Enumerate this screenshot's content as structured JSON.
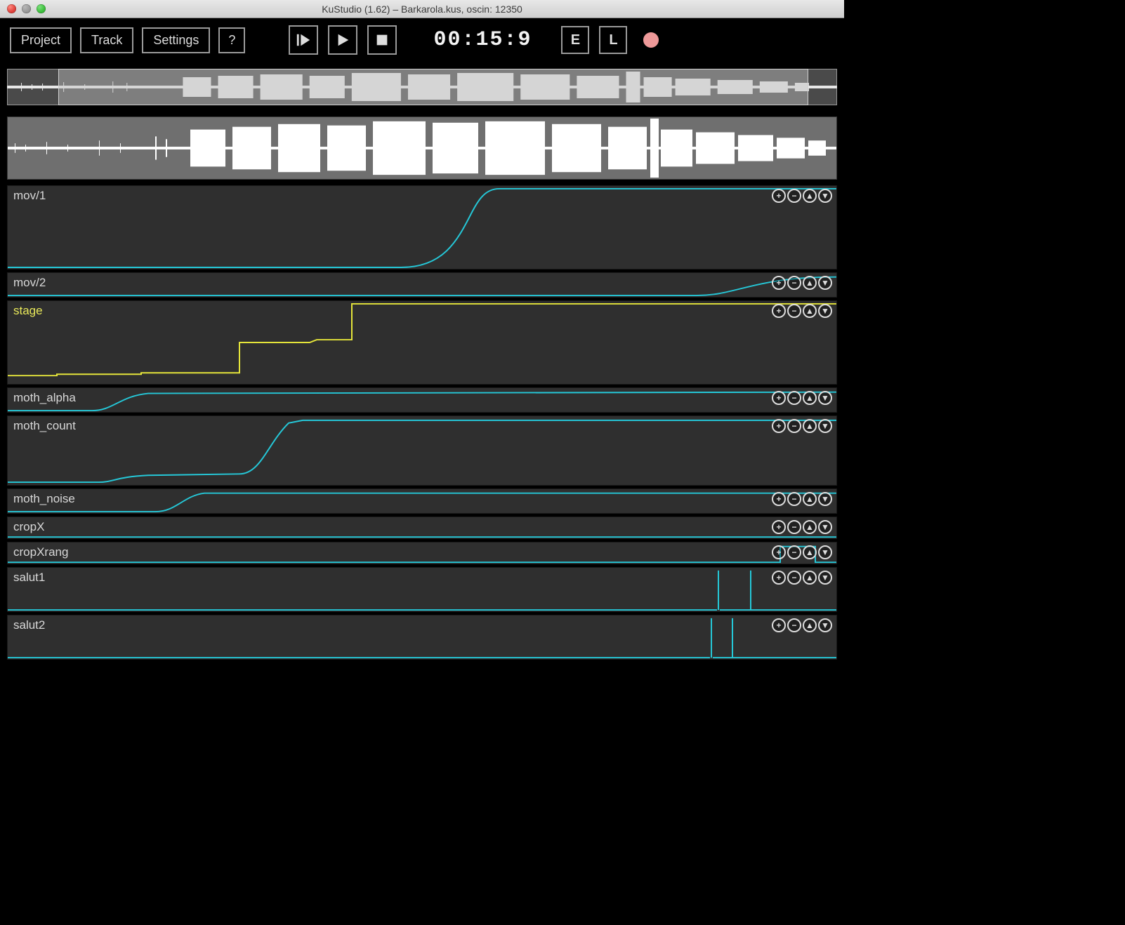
{
  "window": {
    "title": "KuStudio (1.62) – Barkarola.kus, oscin: 12350"
  },
  "toolbar": {
    "project_label": "Project",
    "track_label": "Track",
    "settings_label": "Settings",
    "help_label": "?",
    "timecode": "00:15:9",
    "mode_e": "E",
    "mode_l": "L"
  },
  "overview": {
    "selection_start_pct": 6.2,
    "selection_end_pct": 96.5
  },
  "tracks": [
    {
      "name": "mov/1",
      "color": "cyan",
      "height": "lg"
    },
    {
      "name": "mov/2",
      "color": "cyan",
      "height": "sm"
    },
    {
      "name": "stage",
      "color": "yellow",
      "height": "lg"
    },
    {
      "name": "moth_alpha",
      "color": "cyan",
      "height": "sm"
    },
    {
      "name": "moth_count",
      "color": "cyan",
      "height": "md"
    },
    {
      "name": "moth_noise",
      "color": "cyan",
      "height": "sm"
    },
    {
      "name": "cropX",
      "color": "cyan",
      "height": "xs"
    },
    {
      "name": "cropXrang",
      "color": "cyan",
      "height": "xs"
    },
    {
      "name": "salut1",
      "color": "cyan",
      "height": "sl"
    },
    {
      "name": "salut2",
      "color": "cyan",
      "height": "sl"
    }
  ],
  "track_controls": {
    "plus": "+",
    "minus": "−",
    "up": "▲",
    "down": "▼"
  }
}
